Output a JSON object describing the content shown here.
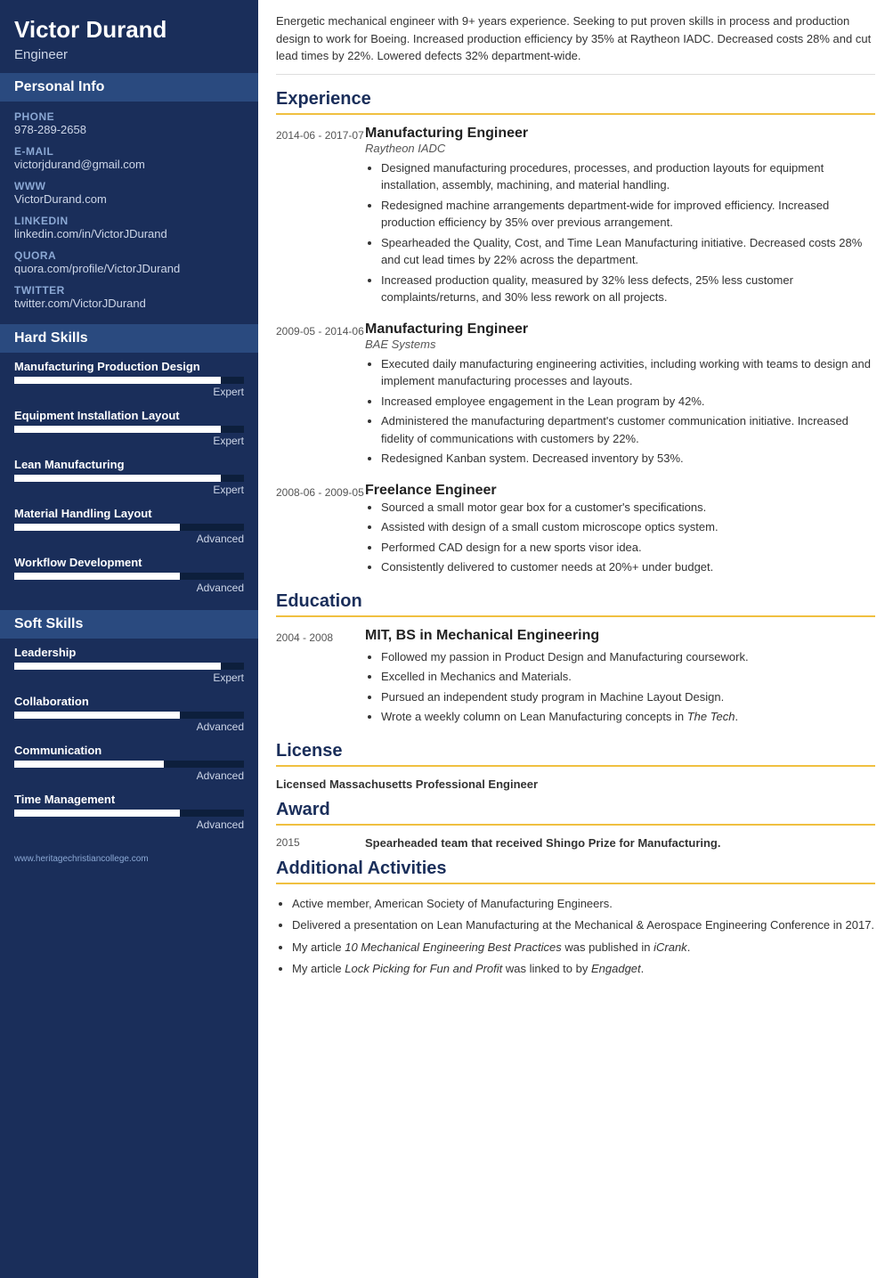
{
  "sidebar": {
    "name": "Victor Durand",
    "title": "Engineer",
    "personal_info_label": "Personal Info",
    "personal": [
      {
        "label": "Phone",
        "value": "978-289-2658"
      },
      {
        "label": "E-mail",
        "value": "victorjdurand@gmail.com"
      },
      {
        "label": "WWW",
        "value": "VictorDurand.com"
      },
      {
        "label": "LinkedIn",
        "value": "linkedin.com/in/VictorJDurand"
      },
      {
        "label": "Quora",
        "value": "quora.com/profile/VictorJDurand"
      },
      {
        "label": "Twitter",
        "value": "twitter.com/VictorJDurand"
      }
    ],
    "hard_skills_label": "Hard Skills",
    "hard_skills": [
      {
        "name": "Manufacturing Production Design",
        "fill": 90,
        "level": "Expert"
      },
      {
        "name": "Equipment Installation Layout",
        "fill": 90,
        "level": "Expert"
      },
      {
        "name": "Lean Manufacturing",
        "fill": 90,
        "level": "Expert"
      },
      {
        "name": "Material Handling Layout",
        "fill": 72,
        "level": "Advanced"
      },
      {
        "name": "Workflow Development",
        "fill": 72,
        "level": "Advanced"
      }
    ],
    "soft_skills_label": "Soft Skills",
    "soft_skills": [
      {
        "name": "Leadership",
        "fill": 90,
        "level": "Expert"
      },
      {
        "name": "Collaboration",
        "fill": 72,
        "level": "Advanced"
      },
      {
        "name": "Communication",
        "fill": 65,
        "level": "Advanced"
      },
      {
        "name": "Time Management",
        "fill": 72,
        "level": "Advanced"
      }
    ],
    "footer_url": "www.heritagechristiancollege.com"
  },
  "main": {
    "summary": "Energetic mechanical engineer with 9+ years experience. Seeking to put proven skills in process and production design to work for Boeing. Increased production efficiency by 35% at Raytheon IADC. Decreased costs 28% and cut lead times by 22%. Lowered defects 32% department-wide.",
    "experience_label": "Experience",
    "experience": [
      {
        "date": "2014-06 - 2017-07",
        "role": "Manufacturing Engineer",
        "company": "Raytheon IADC",
        "bullets": [
          "Designed manufacturing procedures, processes, and production layouts for equipment installation, assembly, machining, and material handling.",
          "Redesigned machine arrangements department-wide for improved efficiency. Increased production efficiency by 35% over previous arrangement.",
          "Spearheaded the Quality, Cost, and Time Lean Manufacturing initiative. Decreased costs 28% and cut lead times by 22% across the department.",
          "Increased production quality, measured by 32% less defects, 25% less customer complaints/returns, and 30% less rework on all projects."
        ]
      },
      {
        "date": "2009-05 - 2014-06",
        "role": "Manufacturing Engineer",
        "company": "BAE Systems",
        "bullets": [
          "Executed daily manufacturing engineering activities, including working with teams to design and implement manufacturing processes and layouts.",
          "Increased employee engagement in the Lean program by 42%.",
          "Administered the manufacturing department's customer communication initiative. Increased fidelity of communications with customers by 22%.",
          "Redesigned Kanban system. Decreased inventory by 53%."
        ]
      },
      {
        "date": "2008-06 - 2009-05",
        "role": "Freelance Engineer",
        "company": "",
        "bullets": [
          "Sourced a small motor gear box for a customer's specifications.",
          "Assisted with design of a small custom microscope optics system.",
          "Performed CAD design for a new sports visor idea.",
          "Consistently delivered to customer needs at 20%+ under budget."
        ]
      }
    ],
    "education_label": "Education",
    "education": [
      {
        "date": "2004 - 2008",
        "degree": "MIT, BS in Mechanical Engineering",
        "bullets": [
          "Followed my passion in Product Design and Manufacturing coursework.",
          "Excelled in Mechanics and Materials.",
          "Pursued an independent study program in Machine Layout Design.",
          "Wrote a weekly column on Lean Manufacturing concepts in The Tech."
        ]
      }
    ],
    "license_label": "License",
    "license": "Licensed Massachusetts Professional Engineer",
    "award_label": "Award",
    "award": {
      "year": "2015",
      "text": "Spearheaded team that received Shingo Prize for Manufacturing."
    },
    "activities_label": "Additional Activities",
    "activities": [
      "Active member, American Society of Manufacturing Engineers.",
      "Delivered a presentation on Lean Manufacturing at the Mechanical & Aerospace Engineering Conference in 2017.",
      "My article 10 Mechanical Engineering Best Practices was published in iCrank.",
      "My article Lock Picking for Fun and Profit was linked to by Engadget."
    ]
  }
}
